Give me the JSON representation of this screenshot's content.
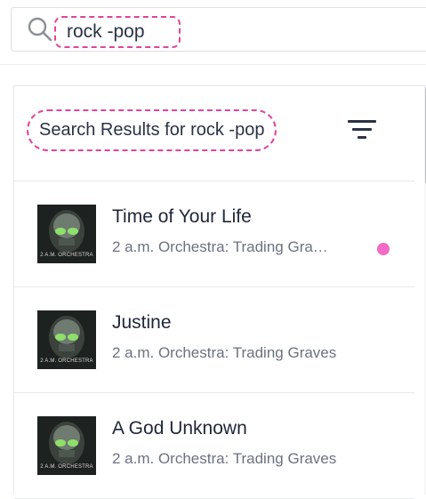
{
  "search": {
    "query": "rock -pop"
  },
  "results": {
    "title": "Search Results for rock -pop",
    "tracks": [
      {
        "title": "Time of Your Life",
        "subtitle": "2 a.m. Orchestra: Trading Gra…",
        "art_caption": "2 A.M. ORCHESTRA",
        "has_indicator": true
      },
      {
        "title": "Justine",
        "subtitle": "2 a.m. Orchestra: Trading Graves",
        "art_caption": "2 A.M. ORCHESTRA",
        "has_indicator": false
      },
      {
        "title": "A God Unknown",
        "subtitle": "2 a.m. Orchestra: Trading Graves",
        "art_caption": "2 A.M. ORCHESTRA",
        "has_indicator": false
      }
    ]
  },
  "icons": {
    "search": "search-icon",
    "filter": "filter-icon"
  },
  "colors": {
    "highlight_dashed": "#e0449a",
    "indicator_dot": "#f36bc4",
    "text_primary": "#1f2638",
    "text_secondary": "#6b7280"
  }
}
